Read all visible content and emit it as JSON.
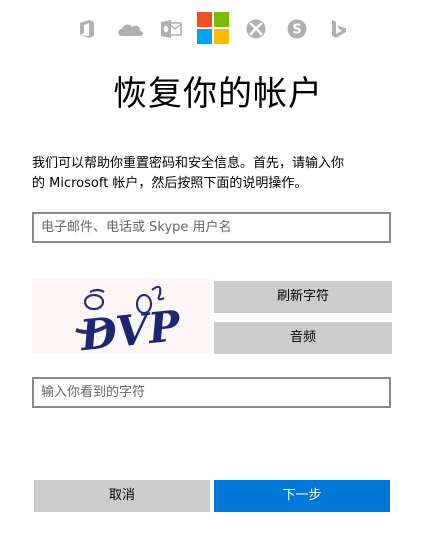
{
  "header": {
    "product_icons": [
      "office-icon",
      "onedrive-icon",
      "outlook-icon",
      "microsoft-logo-icon",
      "xbox-icon",
      "skype-icon",
      "bing-icon"
    ],
    "logo_colors": [
      "#f25022",
      "#7fba00",
      "#00a4ef",
      "#ffb900"
    ],
    "icon_color": "#b0b0b0"
  },
  "page": {
    "title": "恢复你的帐户",
    "description_line1": "我们可以帮助你重置密码和安全信息。首先，请输入你",
    "description_line2": "的 Microsoft 帐户，然后按照下面的说明操作。"
  },
  "form": {
    "email_placeholder": "电子邮件、电话或 Skype 用户名",
    "email_value": "",
    "captcha_text": "DVP",
    "captcha_placeholder": "输入你看到的字符",
    "captcha_value": "",
    "refresh_label": "刷新字符",
    "audio_label": "音频"
  },
  "footer": {
    "cancel_label": "取消",
    "next_label": "下一步"
  },
  "colors": {
    "primary": "#0078d7",
    "secondary_button": "#cccccc",
    "input_border": "#8a8a8a"
  }
}
